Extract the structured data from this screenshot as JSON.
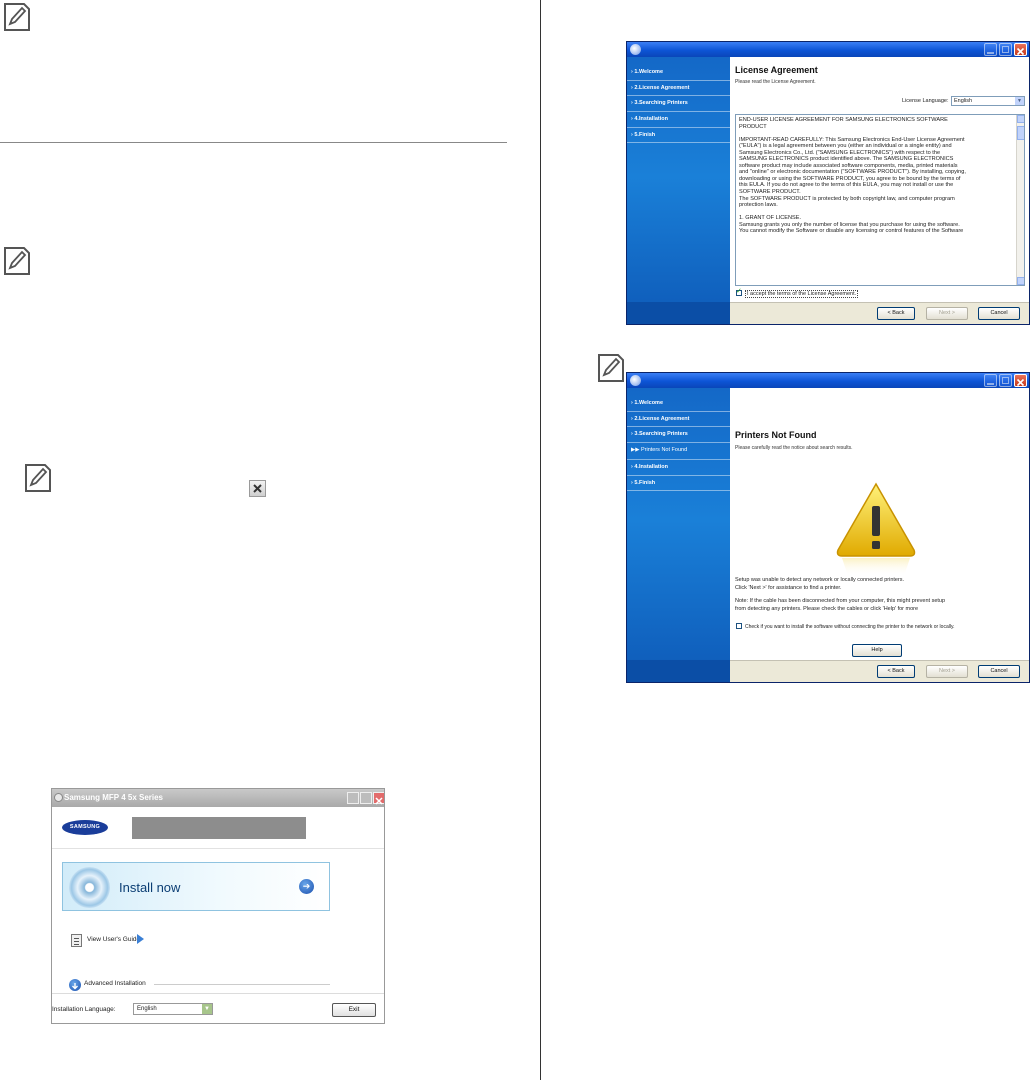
{
  "license_window": {
    "steps": [
      "1.Welcome",
      "2.License Agreement",
      "3.Searching Printers",
      "4.Installation",
      "5.Finish"
    ],
    "title": "License Agreement",
    "subtitle": "Please read the License Agreement.",
    "language_label": "License Language:",
    "language_value": "English",
    "eula_text": "END-USER LICENSE AGREEMENT FOR SAMSUNG ELECTRONICS SOFTWARE\nPRODUCT\n\nIMPORTANT-READ CAREFULLY: This Samsung Electronics End-User License Agreement\n(\"EULA\") is a legal agreement between you (either an individual or a single entity) and\nSamsung Electronics Co., Ltd. (\"SAMSUNG ELECTRONICS\") with respect to the\nSAMSUNG ELECTRONICS product identified above. The SAMSUNG ELECTRONICS\nsoftware product may include associated software components, media, printed materials\nand \"online\" or electronic documentation (\"SOFTWARE PRODUCT\"). By installing, copying,\ndownloading or using the SOFTWARE PRODUCT, you agree to be bound by the terms of\nthis EULA. If you do not agree to the terms of this EULA, you may not install or use the\nSOFTWARE PRODUCT.\nThe SOFTWARE PRODUCT is protected by both copyright law, and computer program\nprotection laws.\n\n1. GRANT OF LICENSE.\nSamsung grants you only the number of license that you purchase for using the software.\nYou cannot modify the Software or disable any licensing or control features of the Software",
    "accept_label": "I accept the terms of the License Agreement.",
    "back_label": "< Back",
    "next_label": "Next >",
    "cancel_label": "Cancel"
  },
  "notfound_window": {
    "steps": [
      "1.Welcome",
      "2.License Agreement",
      "3.Searching Printers",
      "▶▶ Printers Not Found",
      "4.Installation",
      "5.Finish"
    ],
    "title": "Printers Not Found",
    "subtitle": "Please carefully read the notice about search results.",
    "msg1": "Setup was unable to detect any network or locally connected printers.",
    "msg2": "Click 'Next >' for assistance to find a printer.",
    "note1": "Note: If the cable has been disconnected from your computer, this might prevent setup",
    "note2": "from detecting any printers. Please check the cables or click 'Help' for more",
    "check_label": "Check if you want to install the software without connecting the printer to the network or locally.",
    "help_label": "Help",
    "back_label": "< Back",
    "next_label": "Next >",
    "cancel_label": "Cancel"
  },
  "installer_window": {
    "title": "Samsung MFP 4 5x Series",
    "logo_text": "SAMSUNG",
    "install_label": "Install now",
    "guide_label": "View User's Guide",
    "advanced_label": "Advanced Installation",
    "language_label": "Installation Language:",
    "language_value": "English",
    "exit_label": "Exit"
  },
  "colors": {
    "xp_title": "#0d54d6",
    "sidebar_blue": "#1a80d8",
    "warning_yellow": "#f2c500"
  }
}
